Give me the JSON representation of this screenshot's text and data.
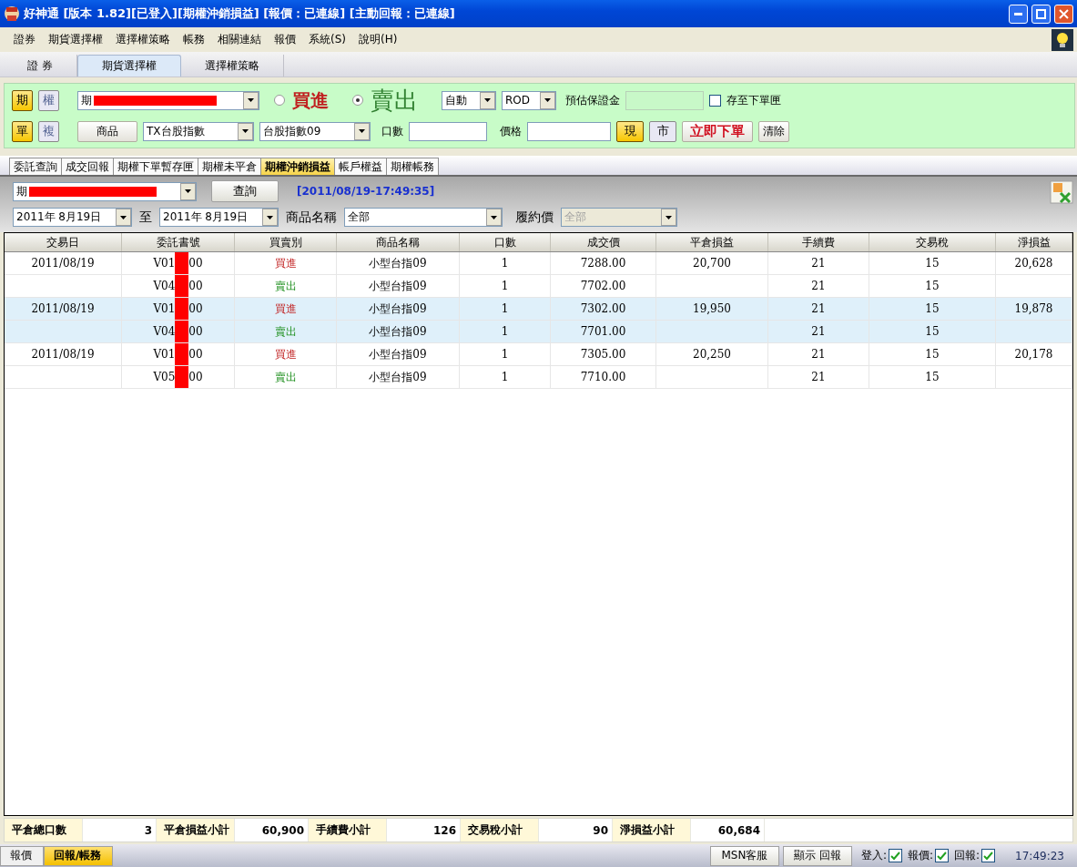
{
  "window": {
    "title": "好神通 [版本 1.82][已登入][期權沖銷損益] [報價：已連線] [主動回報：已連線]"
  },
  "menu": [
    "證券",
    "期貨選擇權",
    "選擇權策略",
    "帳務",
    "相關連結",
    "報價",
    "系統(S)",
    "說明(H)"
  ],
  "top_tabs": [
    {
      "label": "證 券",
      "selected": false
    },
    {
      "label": "期貨選擇權",
      "selected": true
    },
    {
      "label": "選擇權策略",
      "selected": false
    }
  ],
  "order_panel": {
    "market_toggle": [
      {
        "label": "期",
        "selected": true
      },
      {
        "label": "權",
        "selected": false
      }
    ],
    "account": {
      "value": "期"
    },
    "side": [
      {
        "label": "買進",
        "selected": false,
        "kind": "buy"
      },
      {
        "label": "賣出",
        "selected": true,
        "kind": "sell"
      }
    ],
    "condition": {
      "value": "自動"
    },
    "time_in_force": {
      "value": "ROD"
    },
    "margin_label": "預估保證金",
    "save_checkbox": {
      "label": "存至下單匣",
      "checked": false
    },
    "mode_toggle": [
      {
        "label": "單",
        "selected": true
      },
      {
        "label": "複",
        "selected": false
      }
    ],
    "product_button": "商品",
    "product": {
      "value": "TX台股指數"
    },
    "contract": {
      "value": "台股指數09"
    },
    "qty_label": "口數",
    "price_label": "價格",
    "price_type": [
      {
        "label": "現",
        "selected": true
      },
      {
        "label": "市",
        "selected": false
      }
    ],
    "submit_button": "立即下單",
    "clear_button": "清除"
  },
  "report_tabs": [
    {
      "label": "委託查詢",
      "selected": false
    },
    {
      "label": "成交回報",
      "selected": false
    },
    {
      "label": "期權下單暫存匣",
      "selected": false
    },
    {
      "label": "期權未平倉",
      "selected": false
    },
    {
      "label": "期權沖銷損益",
      "selected": true
    },
    {
      "label": "帳戶權益",
      "selected": false
    },
    {
      "label": "期權帳務",
      "selected": false
    }
  ],
  "query": {
    "account": {
      "value": "期"
    },
    "query_button": "查詢",
    "timestamp": "[2011/08/19-17:49:35]",
    "date_from": "2011年  8月19日",
    "to_label": "至",
    "date_to": "2011年  8月19日",
    "product_label": "商品名稱",
    "product": {
      "value": "全部"
    },
    "strike_label": "履約價",
    "strike": {
      "value": "全部",
      "disabled": true
    }
  },
  "table": {
    "columns": [
      "交易日",
      "委託書號",
      "買賣別",
      "商品名稱",
      "口數",
      "成交價",
      "平倉損益",
      "手續費",
      "交易稅",
      "淨損益"
    ],
    "rows": [
      {
        "date": "2011/08/19",
        "order_prefix": "V01",
        "order_suffix": "00",
        "side": {
          "label": "買進",
          "kind": "buy"
        },
        "product": "小型台指09",
        "qty": "1",
        "price": "7288.00",
        "pnl": "20,700",
        "fee": "21",
        "tax": "15",
        "net": "20,628",
        "highlighted": false
      },
      {
        "date": "",
        "order_prefix": "V04",
        "order_suffix": "00",
        "side": {
          "label": "賣出",
          "kind": "sell"
        },
        "product": "小型台指09",
        "qty": "1",
        "price": "7702.00",
        "pnl": "",
        "fee": "21",
        "tax": "15",
        "net": "",
        "highlighted": false
      },
      {
        "date": "2011/08/19",
        "order_prefix": "V01",
        "order_suffix": "00",
        "side": {
          "label": "買進",
          "kind": "buy"
        },
        "product": "小型台指09",
        "qty": "1",
        "price": "7302.00",
        "pnl": "19,950",
        "fee": "21",
        "tax": "15",
        "net": "19,878",
        "highlighted": true
      },
      {
        "date": "",
        "order_prefix": "V04",
        "order_suffix": "00",
        "side": {
          "label": "賣出",
          "kind": "sell"
        },
        "product": "小型台指09",
        "qty": "1",
        "price": "7701.00",
        "pnl": "",
        "fee": "21",
        "tax": "15",
        "net": "",
        "highlighted": true
      },
      {
        "date": "2011/08/19",
        "order_prefix": "V01",
        "order_suffix": "00",
        "side": {
          "label": "買進",
          "kind": "buy"
        },
        "product": "小型台指09",
        "qty": "1",
        "price": "7305.00",
        "pnl": "20,250",
        "fee": "21",
        "tax": "15",
        "net": "20,178",
        "highlighted": false
      },
      {
        "date": "",
        "order_prefix": "V05",
        "order_suffix": "00",
        "side": {
          "label": "賣出",
          "kind": "sell"
        },
        "product": "小型台指09",
        "qty": "1",
        "price": "7710.00",
        "pnl": "",
        "fee": "21",
        "tax": "15",
        "net": "",
        "highlighted": false
      }
    ]
  },
  "summary": [
    {
      "label": "平倉總口數",
      "value": "3"
    },
    {
      "label": "平倉損益小計",
      "value": "60,900"
    },
    {
      "label": "手續費小計",
      "value": "126"
    },
    {
      "label": "交易稅小計",
      "value": "90"
    },
    {
      "label": "淨損益小計",
      "value": "60,684"
    }
  ],
  "status": {
    "tabs": [
      {
        "label": "報價",
        "selected": false
      },
      {
        "label": "回報/帳務",
        "selected": true
      }
    ],
    "buttons": [
      "MSN客服",
      "顯示 回報"
    ],
    "indicators": [
      {
        "label": "登入:",
        "checked": true
      },
      {
        "label": "報價:",
        "checked": true
      },
      {
        "label": "回報:",
        "checked": true
      }
    ],
    "time": "17:49:23"
  }
}
